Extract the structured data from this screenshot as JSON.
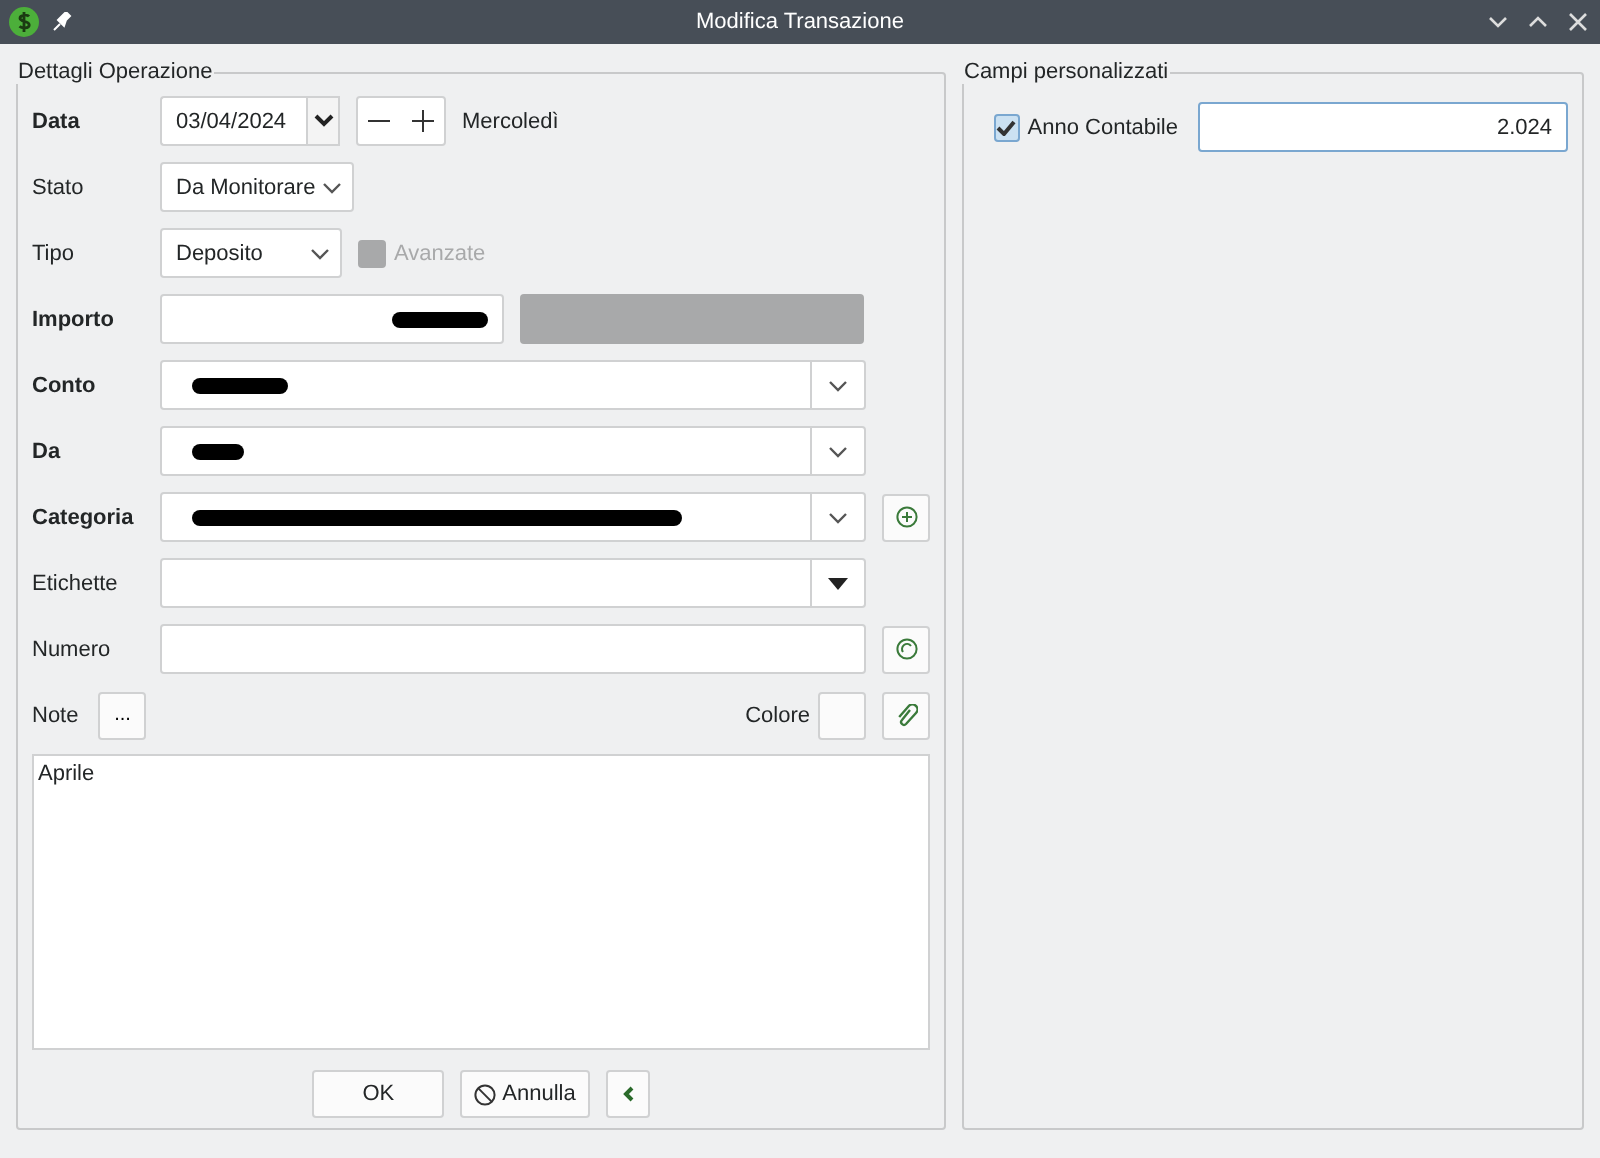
{
  "window": {
    "title": "Modifica Transazione"
  },
  "details": {
    "legend": "Dettagli Operazione",
    "rows": [
      {
        "kind": "date",
        "label": "Data",
        "required": true,
        "value": "03/04/2024",
        "weekday": "Mercoledì"
      },
      {
        "kind": "combo",
        "label": "Stato",
        "required": false,
        "value": "Da Monitorare"
      },
      {
        "kind": "type",
        "label": "Tipo",
        "required": false,
        "value": "Deposito",
        "option": {
          "label": "Avanzate",
          "checked": false,
          "disabled": true
        }
      },
      {
        "kind": "amount",
        "label": "Importo",
        "required": true
      },
      {
        "kind": "account",
        "label": "Conto",
        "required": true
      },
      {
        "kind": "payee",
        "label": "Da",
        "required": true
      },
      {
        "kind": "category",
        "label": "Categoria",
        "required": true
      },
      {
        "kind": "tags",
        "label": "Etichette",
        "required": false
      },
      {
        "kind": "number",
        "label": "Numero",
        "required": false
      },
      {
        "kind": "notes",
        "label": "Note",
        "required": false,
        "more": "...",
        "color_label": "Colore"
      }
    ],
    "notes_text": "Aprile"
  },
  "buttons": [
    {
      "label": "OK",
      "kind": "ok"
    },
    {
      "label": "Annulla",
      "kind": "cancel"
    },
    {
      "kind": "collapse"
    }
  ],
  "custom_fields": {
    "legend": "Campi personalizzati",
    "fields": [
      {
        "label": "Anno Contabile",
        "checked": true,
        "value": "2.024"
      }
    ]
  }
}
